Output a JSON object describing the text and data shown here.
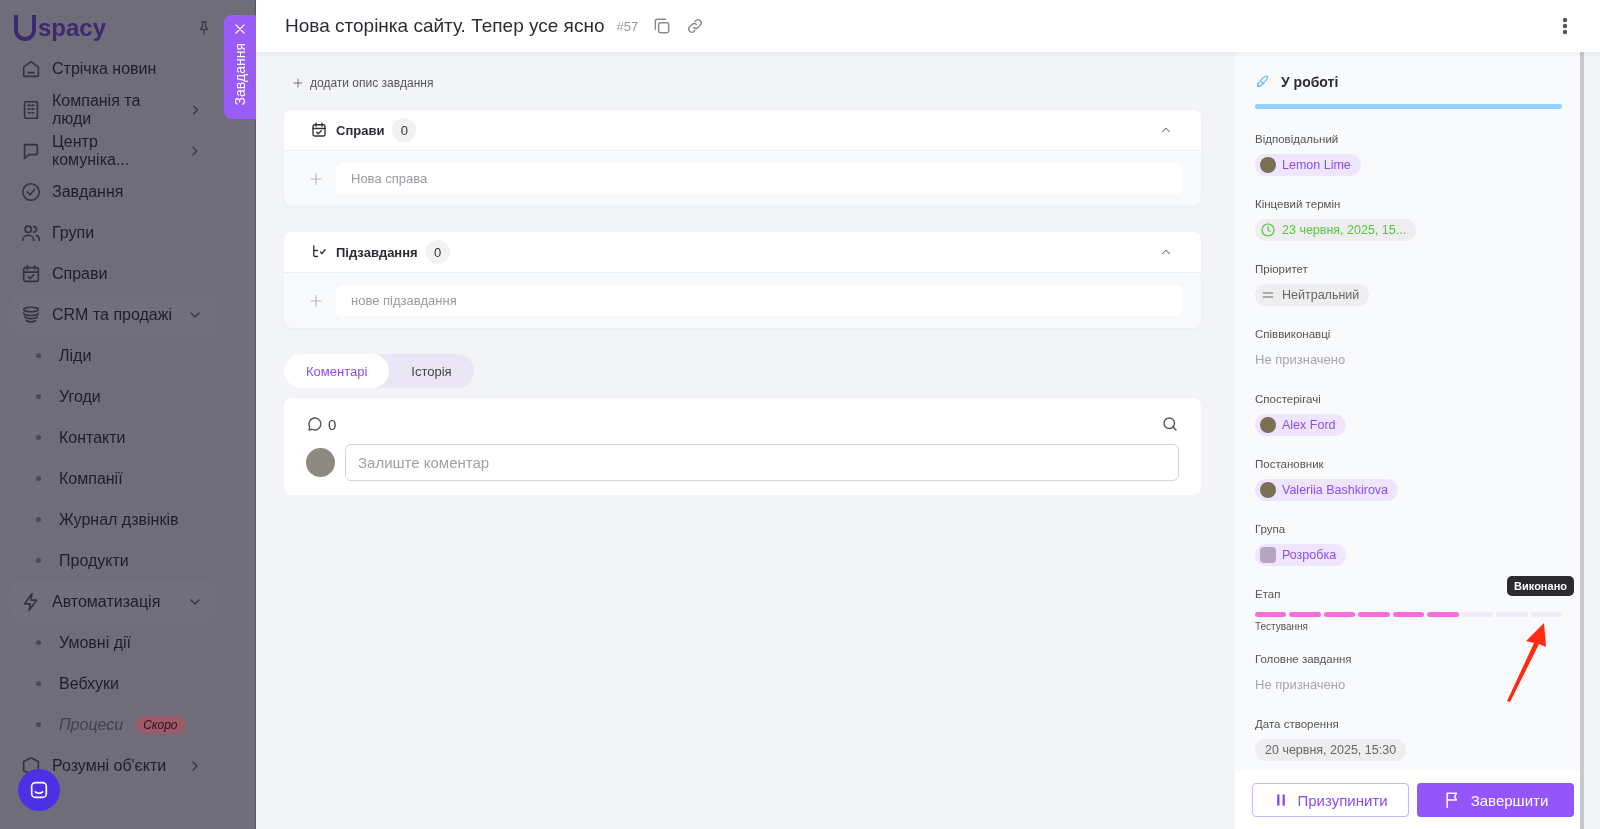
{
  "sidebar": {
    "logo": "spacy",
    "items": [
      {
        "label": "Стрічка новин"
      },
      {
        "label": "Компанія та люди",
        "expanded": false
      },
      {
        "label": "Центр комуніка...",
        "expanded": false
      },
      {
        "label": "Завдання"
      },
      {
        "label": "Групи"
      },
      {
        "label": "Справи"
      },
      {
        "label": "CRM та продажі",
        "expanded": true,
        "children": [
          {
            "label": "Ліди"
          },
          {
            "label": "Угоди"
          },
          {
            "label": "Контакти"
          },
          {
            "label": "Компанії"
          },
          {
            "label": "Журнал дзвінків"
          },
          {
            "label": "Продукти"
          }
        ]
      },
      {
        "label": "Автоматизація",
        "expanded": true,
        "children": [
          {
            "label": "Умовні дії"
          },
          {
            "label": "Вебхуки"
          },
          {
            "label": "Процеси",
            "disabled": true,
            "badge": "Скоро"
          }
        ]
      },
      {
        "label": "Розумні об'єкти",
        "expanded": false
      }
    ]
  },
  "side_tab": {
    "label": "Завдання"
  },
  "task": {
    "title": "Нова сторінка сайту. Тепер усе ясно",
    "number": "#57"
  },
  "add_description": "додати опис завдання",
  "sections": [
    {
      "title": "Справи",
      "count": "0",
      "expanded": true,
      "placeholder": "Нова справа"
    },
    {
      "title": "Підзавдання",
      "count": "0",
      "expanded": true,
      "placeholder": "нове підзавдання"
    }
  ],
  "comment_tabs": [
    {
      "label": "Коментарі",
      "selected": true
    },
    {
      "label": "Історія",
      "selected": false
    }
  ],
  "comments": {
    "count": "0",
    "placeholder": "Залиште коментар"
  },
  "details": {
    "status": {
      "label": "У роботі",
      "level": 1
    },
    "fields": [
      {
        "label": "Відповідальний",
        "kind": "person",
        "value": "Lemon Lime"
      },
      {
        "label": "Кінцевий термін",
        "kind": "date",
        "value": "23 червня, 2025, 15..."
      },
      {
        "label": "Пріоритет",
        "kind": "priority",
        "value": "Нейтральний"
      },
      {
        "label": "Співвиконавці",
        "kind": "empty",
        "value": "Не призначено"
      },
      {
        "label": "Спостерігачі",
        "kind": "person",
        "value": "Alex Ford"
      },
      {
        "label": "Постановник",
        "kind": "person",
        "value": "Valeriia Bashkirova"
      },
      {
        "label": "Група",
        "kind": "group",
        "value": "Розробка"
      },
      {
        "label": "Етап",
        "kind": "stage",
        "value": "Тестування",
        "tooltip": "Виконано",
        "segments": [
          {
            "filled": true
          },
          {
            "filled": true
          },
          {
            "filled": true
          },
          {
            "filled": true
          },
          {
            "filled": true
          },
          {
            "filled": true
          },
          {
            "filled": false
          },
          {
            "filled": false
          },
          {
            "filled": false
          }
        ]
      },
      {
        "label": "Головне завдання",
        "kind": "empty",
        "value": "Не призначено"
      },
      {
        "label": "Дата створення",
        "kind": "chip",
        "value": "20 червня, 2025, 15:30"
      }
    ]
  },
  "buttons": [
    {
      "label": "Призупинити",
      "kind": "pause"
    },
    {
      "label": "Завершити",
      "kind": "finish"
    }
  ]
}
